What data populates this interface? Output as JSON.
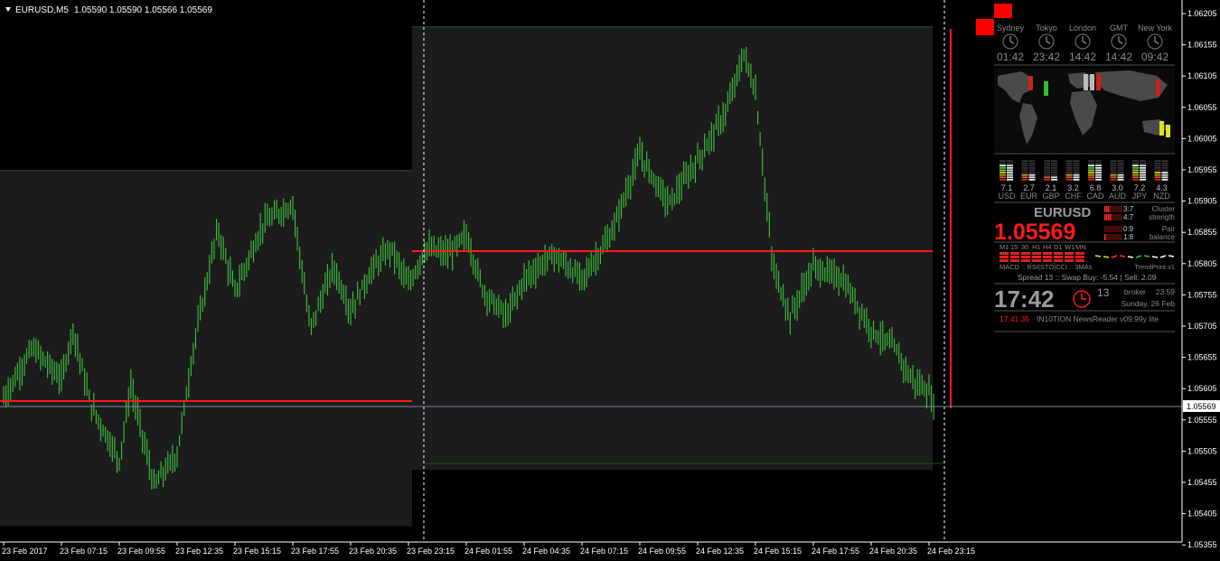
{
  "header": {
    "symbol_title": "EURUSD,M5",
    "ohlc": "1.05590 1.05590 1.05566 1.05569"
  },
  "price_axis": {
    "ticks": [
      "1.06205",
      "1.06155",
      "1.06105",
      "1.06055",
      "1.06005",
      "1.05955",
      "1.05905",
      "1.05855",
      "1.05805",
      "1.05755",
      "1.05705",
      "1.05655",
      "1.05605",
      "1.05555",
      "1.05505",
      "1.05455",
      "1.05405",
      "1.05355"
    ],
    "current_price": "1.05569"
  },
  "time_axis": {
    "labels": [
      "23 Feb 2017",
      "23 Feb 07:15",
      "23 Feb 09:55",
      "23 Feb 12:35",
      "23 Feb 15:15",
      "23 Feb 17:55",
      "23 Feb 20:35",
      "23 Feb 23:15",
      "24 Feb 01:55",
      "24 Feb 04:35",
      "24 Feb 07:15",
      "24 Feb 09:55",
      "24 Feb 12:35",
      "24 Feb 15:15",
      "24 Feb 17:55",
      "24 Feb 20:35",
      "24 Feb 23:15"
    ]
  },
  "colors": {
    "background": "#000000",
    "bars": "#3fc23f",
    "session_box": "#1c1c1c",
    "level_line": "#ff1a1a",
    "grid_text": "#ffffff",
    "panel_text": "#8a8a8a"
  },
  "clocks": {
    "items": [
      {
        "city": "Sydney",
        "time": "01:42"
      },
      {
        "city": "Tokyo",
        "time": "23:42"
      },
      {
        "city": "London",
        "time": "14:42"
      },
      {
        "city": "GMT",
        "time": "14:42"
      },
      {
        "city": "New York",
        "time": "09:42"
      }
    ]
  },
  "strength": {
    "items": [
      {
        "value": "7.1",
        "ccy": "USD"
      },
      {
        "value": "2.7",
        "ccy": "EUR"
      },
      {
        "value": "2.1",
        "ccy": "GBP"
      },
      {
        "value": "3.2",
        "ccy": "CHF"
      },
      {
        "value": "6.8",
        "ccy": "CAD"
      },
      {
        "value": "3.0",
        "ccy": "AUD"
      },
      {
        "value": "7.2",
        "ccy": "JPY"
      },
      {
        "value": "4.3",
        "ccy": "NZD"
      }
    ]
  },
  "pair_panel": {
    "symbol": "EURUSD",
    "price": "1.05569",
    "ratios": [
      "3:7",
      "4:7",
      "0:9",
      "1:8"
    ],
    "cluster_label_1": "Cluster",
    "cluster_label_2": "strength",
    "pair_label_1": "Pair",
    "pair_label_2": "balance",
    "timeframes": [
      "M1",
      "15",
      "30",
      "H1",
      "H4",
      "D1",
      "W1",
      "MN"
    ],
    "indicators": "MACD :: RSI|STO|CCI :: 3MAs",
    "trendprint": "TrendPrint.v1",
    "spread_line": "Spread   13  ::  Swap Buy: -5.54  |  Sell: 2.09"
  },
  "time_panel": {
    "big_time": "17:42",
    "seconds": "13",
    "broker_label": "broker",
    "broker_time": "23:59",
    "day": "Sunday, 26 Feb",
    "news_time": "17:41:35",
    "news_text": "IN10TION NewsReader v09.99y lite"
  },
  "chart_data": {
    "type": "bar",
    "title": "",
    "ylim": [
      1.05335,
      1.06225
    ],
    "x_categories": [
      "23 Feb 2017",
      "23 Feb 07:15",
      "23 Feb 09:55",
      "23 Feb 12:35",
      "23 Feb 15:15",
      "23 Feb 17:55",
      "23 Feb 20:35",
      "23 Feb 23:15",
      "24 Feb 01:55",
      "24 Feb 04:35",
      "24 Feb 07:15",
      "24 Feb 09:55",
      "24 Feb 12:35",
      "24 Feb 15:15",
      "24 Feb 17:55",
      "24 Feb 20:35",
      "24 Feb 23:15"
    ],
    "trend_points": [
      [
        0,
        1.0559
      ],
      [
        0.5,
        1.0567
      ],
      [
        1,
        1.0562
      ],
      [
        1.2,
        1.057
      ],
      [
        1.5,
        1.0558
      ],
      [
        2,
        1.0549
      ],
      [
        2.2,
        1.0561
      ],
      [
        2.6,
        1.0545
      ],
      [
        3,
        1.055
      ],
      [
        3.3,
        1.0568
      ],
      [
        3.7,
        1.0586
      ],
      [
        4,
        1.0576
      ],
      [
        4.5,
        1.0587
      ],
      [
        5,
        1.059
      ],
      [
        5.3,
        1.057
      ],
      [
        5.7,
        1.058
      ],
      [
        6,
        1.0573
      ],
      [
        6.4,
        1.058
      ],
      [
        6.7,
        1.0583
      ],
      [
        7,
        1.0577
      ],
      [
        7.3,
        1.0583
      ],
      [
        7.7,
        1.0582
      ],
      [
        8,
        1.0585
      ],
      [
        8.3,
        1.0576
      ],
      [
        8.7,
        1.0572
      ],
      [
        9,
        1.0578
      ],
      [
        9.5,
        1.0582
      ],
      [
        10,
        1.0578
      ],
      [
        10.5,
        1.0585
      ],
      [
        11,
        1.0598
      ],
      [
        11.5,
        1.059
      ],
      [
        12,
        1.0597
      ],
      [
        12.5,
        1.0605
      ],
      [
        12.8,
        1.0614
      ],
      [
        13,
        1.0608
      ],
      [
        13.3,
        1.058
      ],
      [
        13.6,
        1.0572
      ],
      [
        14,
        1.058
      ],
      [
        14.5,
        1.0578
      ],
      [
        15,
        1.057
      ],
      [
        15.4,
        1.0567
      ],
      [
        15.7,
        1.0562
      ],
      [
        16,
        1.056
      ],
      [
        16.1,
        1.0557
      ]
    ],
    "session_boxes": [
      {
        "from": "23 Feb 2017",
        "to": "23 Feb 23:15",
        "high": 1.05955,
        "low": 1.05385
      },
      {
        "from": "23 Feb 23:15",
        "to": "24 Feb 23:15",
        "high": 1.06185,
        "low": 1.05475
      }
    ],
    "levels": [
      {
        "price": 1.05585,
        "from": "23 Feb 2017",
        "to": "23 Feb 23:15"
      },
      {
        "price": 1.05825,
        "from": "23 Feb 23:15",
        "to": "24 Feb 23:15"
      }
    ],
    "current_price": 1.05569
  }
}
